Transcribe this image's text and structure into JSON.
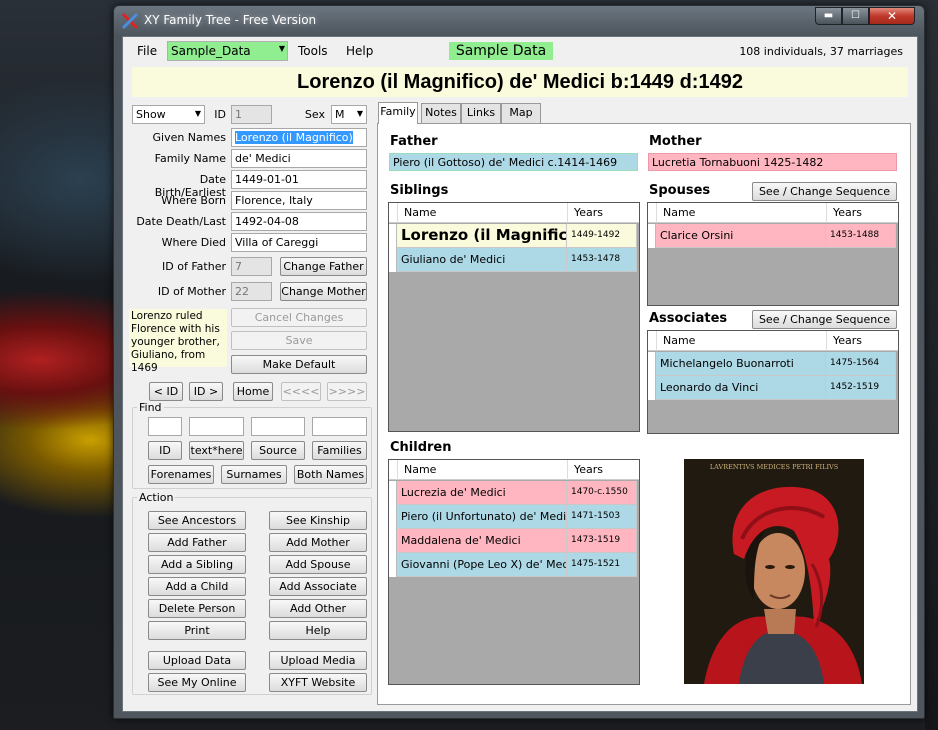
{
  "app": {
    "title": "XY Family Tree - Free Version",
    "window_controls": {
      "minimize": "▬",
      "maximize": "☐",
      "close": "✕"
    }
  },
  "menubar": {
    "file": "File",
    "database": "Sample_Data",
    "tools": "Tools",
    "help": "Help",
    "database_title": "Sample Data",
    "stats": "108 individuals, 37 marriages"
  },
  "header": {
    "person_title": "Lorenzo (il Magnifico) de' Medici  b:1449 d:1492"
  },
  "left": {
    "show_select": "Show",
    "id_label": "ID",
    "id_value": "1",
    "sex_label": "Sex",
    "sex_value": "M",
    "fields": {
      "given_names": {
        "label": "Given Names",
        "value": "Lorenzo (il Magnifico)"
      },
      "family_name": {
        "label": "Family Name",
        "value": "de' Medici"
      },
      "date_birth": {
        "label": "Date Birth/Earliest",
        "value": "1449-01-01"
      },
      "where_born": {
        "label": "Where Born",
        "value": "Florence, Italy"
      },
      "date_death": {
        "label": "Date Death/Last",
        "value": "1492-04-08"
      },
      "where_died": {
        "label": "Where Died",
        "value": "Villa of Careggi"
      },
      "id_father": {
        "label": "ID of Father",
        "value": "7"
      },
      "id_mother": {
        "label": "ID of Mother",
        "value": "22"
      }
    },
    "buttons": {
      "change_father": "Change Father",
      "change_mother": "Change Mother",
      "cancel_changes": "Cancel Changes",
      "save": "Save",
      "make_default": "Make Default"
    },
    "note": "Lorenzo ruled Florence with his younger brother, Giuliano, from 1469",
    "nav": {
      "prev_id": "< ID",
      "next_id": "ID >",
      "home": "Home",
      "back": "<<<<",
      "forward": ">>>>"
    },
    "find": {
      "label": "Find",
      "id": "ID",
      "text_here": "text*here",
      "source": "Source",
      "families": "Families",
      "forenames": "Forenames",
      "surnames": "Surnames",
      "both_names": "Both Names"
    },
    "action": {
      "label": "Action",
      "see_ancestors": "See Ancestors",
      "see_kinship": "See Kinship",
      "add_father": "Add Father",
      "add_mother": "Add Mother",
      "add_sibling": "Add a Sibling",
      "add_spouse": "Add Spouse",
      "add_child": "Add a Child",
      "add_associate": "Add Associate",
      "delete_person": "Delete Person",
      "add_other": "Add Other",
      "print": "Print",
      "help": "Help",
      "upload_data": "Upload Data",
      "upload_media": "Upload Media",
      "see_my_online": "See My Online",
      "xyft_website": "XYFT Website"
    }
  },
  "tabs": [
    "Family",
    "Notes",
    "Links",
    "Map"
  ],
  "family": {
    "father_title": "Father",
    "father": "Piero (il Gottoso) de' Medici c.1414-1469",
    "mother_title": "Mother",
    "mother": "Lucretia Tornabuoni 1425-1482",
    "siblings_title": "Siblings",
    "spouses_title": "Spouses",
    "associates_title": "Associates",
    "children_title": "Children",
    "see_change_sequence": "See / Change Sequence",
    "col_name": "Name",
    "col_years": "Years",
    "siblings": [
      {
        "name": "Lorenzo (il Magnific...",
        "years": "1449-1492",
        "color": "#fafadc",
        "big": true
      },
      {
        "name": "Giuliano de' Medici",
        "years": "1453-1478",
        "color": "#add8e6"
      }
    ],
    "spouses": [
      {
        "name": "Clarice Orsini",
        "years": "1453-1488",
        "color": "#ffb6c1"
      }
    ],
    "associates": [
      {
        "name": "Michelangelo Buonarroti",
        "years": "1475-1564",
        "color": "#add8e6"
      },
      {
        "name": "Leonardo da Vinci",
        "years": "1452-1519",
        "color": "#add8e6"
      }
    ],
    "children": [
      {
        "name": "Lucrezia de' Medici",
        "years": "1470-c.1550",
        "color": "#ffb6c1"
      },
      {
        "name": "Piero (il Unfortunato) de' Medici",
        "years": "1471-1503",
        "color": "#add8e6"
      },
      {
        "name": "Maddalena de' Medici",
        "years": "1473-1519",
        "color": "#ffb6c1"
      },
      {
        "name": "Giovanni (Pope Leo X) de' Medici",
        "years": "1475-1521",
        "color": "#add8e6"
      }
    ],
    "portrait_caption": "LAVRENTIVS MEDICES  PETRI FILIVS"
  },
  "colors": {
    "male": "#add8e6",
    "female": "#ffb6c1",
    "self": "#fafadc",
    "database": "#90ee90"
  }
}
